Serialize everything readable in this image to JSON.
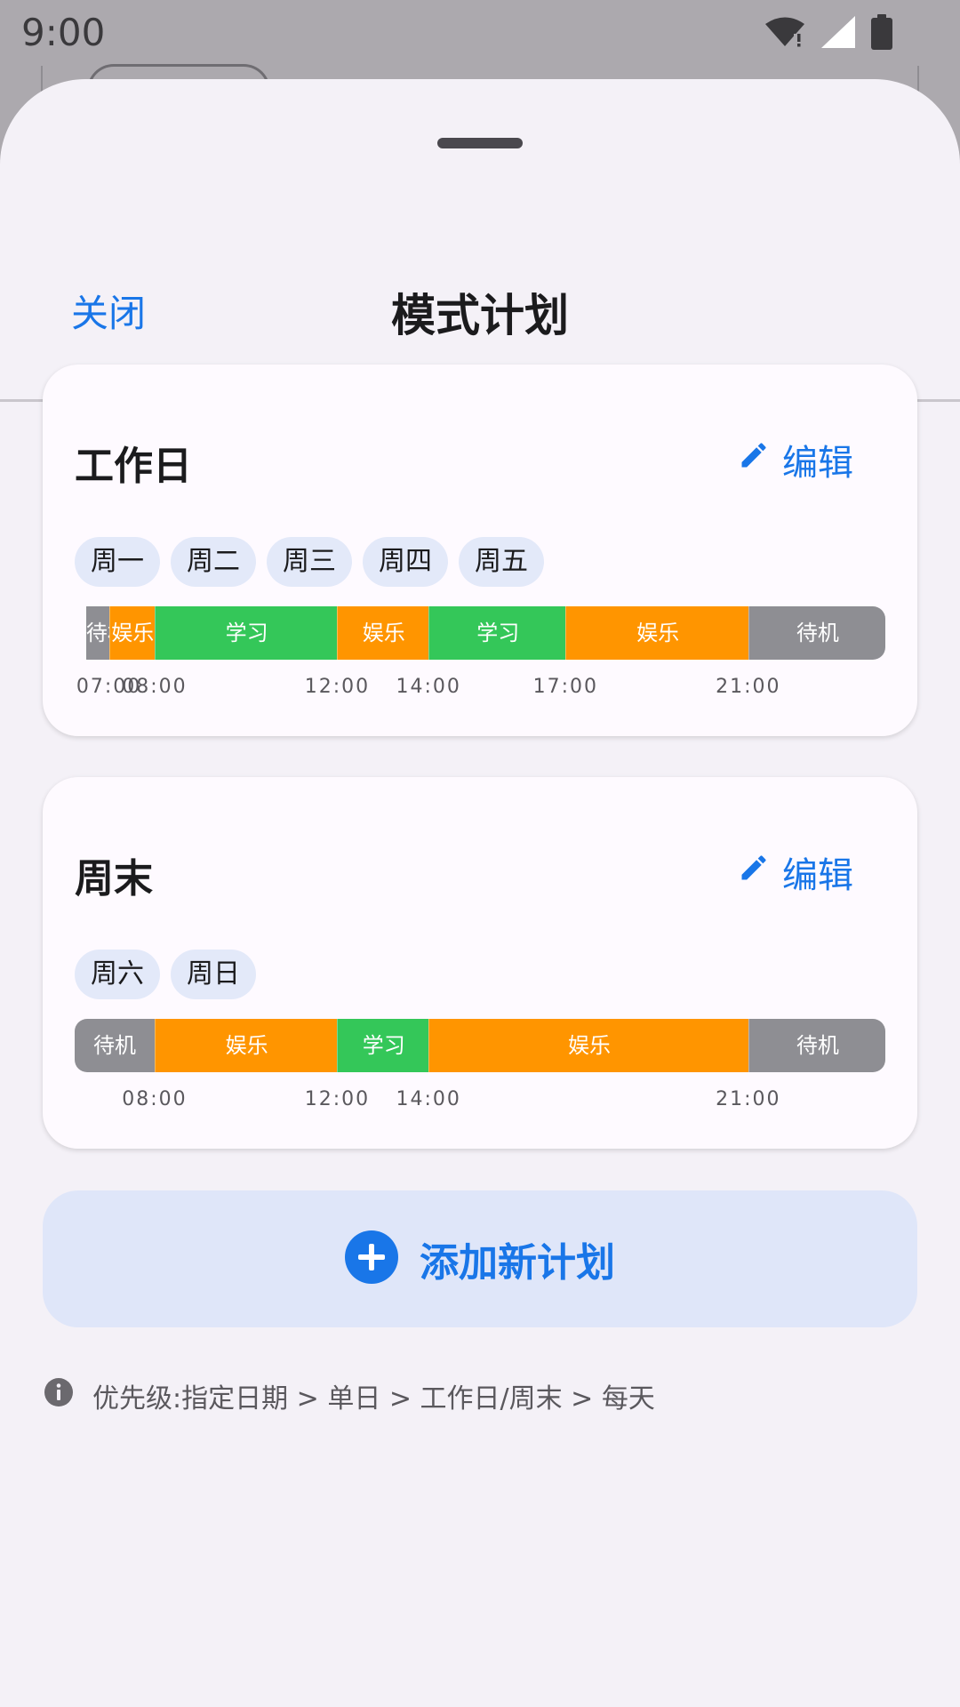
{
  "status_bar": {
    "time": "9:00"
  },
  "sheet": {
    "close_label": "关闭",
    "title": "模式计划"
  },
  "plans": [
    {
      "name": "工作日",
      "edit_label": "编辑",
      "days": [
        "周一",
        "周二",
        "周三",
        "周四",
        "周五"
      ],
      "segments": [
        {
          "label": "待机",
          "type": "standby",
          "start": "06:30",
          "end": "07:00"
        },
        {
          "label": "娱乐",
          "type": "entertainment",
          "start": "07:00",
          "end": "08:00"
        },
        {
          "label": "学习",
          "type": "study",
          "start": "08:00",
          "end": "12:00"
        },
        {
          "label": "娱乐",
          "type": "entertainment",
          "start": "12:00",
          "end": "14:00"
        },
        {
          "label": "学习",
          "type": "study",
          "start": "14:00",
          "end": "17:00"
        },
        {
          "label": "娱乐",
          "type": "entertainment",
          "start": "17:00",
          "end": "21:00"
        },
        {
          "label": "待机",
          "type": "standby",
          "start": "21:00",
          "end": "24:00"
        }
      ],
      "time_labels": [
        "07:00",
        "08:00",
        "12:00",
        "14:00",
        "17:00",
        "21:00"
      ]
    },
    {
      "name": "周末",
      "edit_label": "编辑",
      "days": [
        "周六",
        "周日"
      ],
      "segments": [
        {
          "label": "待机",
          "type": "standby",
          "start": "06:15",
          "end": "08:00"
        },
        {
          "label": "娱乐",
          "type": "entertainment",
          "start": "08:00",
          "end": "12:00"
        },
        {
          "label": "学习",
          "type": "study",
          "start": "12:00",
          "end": "14:00"
        },
        {
          "label": "娱乐",
          "type": "entertainment",
          "start": "14:00",
          "end": "21:00"
        },
        {
          "label": "待机",
          "type": "standby",
          "start": "21:00",
          "end": "24:00"
        }
      ],
      "time_labels": [
        "08:00",
        "12:00",
        "14:00",
        "21:00"
      ]
    }
  ],
  "timeline_range": [
    "06:15",
    "24:00"
  ],
  "mode_colors": {
    "standby": "#8e8e93",
    "entertainment": "#ff9500",
    "study": "#34c759"
  },
  "add_plan_label": "添加新计划",
  "priority_note": "优先级:指定日期 > 单日 > 工作日/周末 > 每天",
  "icons": {
    "edit": "pencil-icon",
    "add": "plus-circle-icon",
    "info": "info-icon"
  },
  "accent_color": "#1976e8"
}
